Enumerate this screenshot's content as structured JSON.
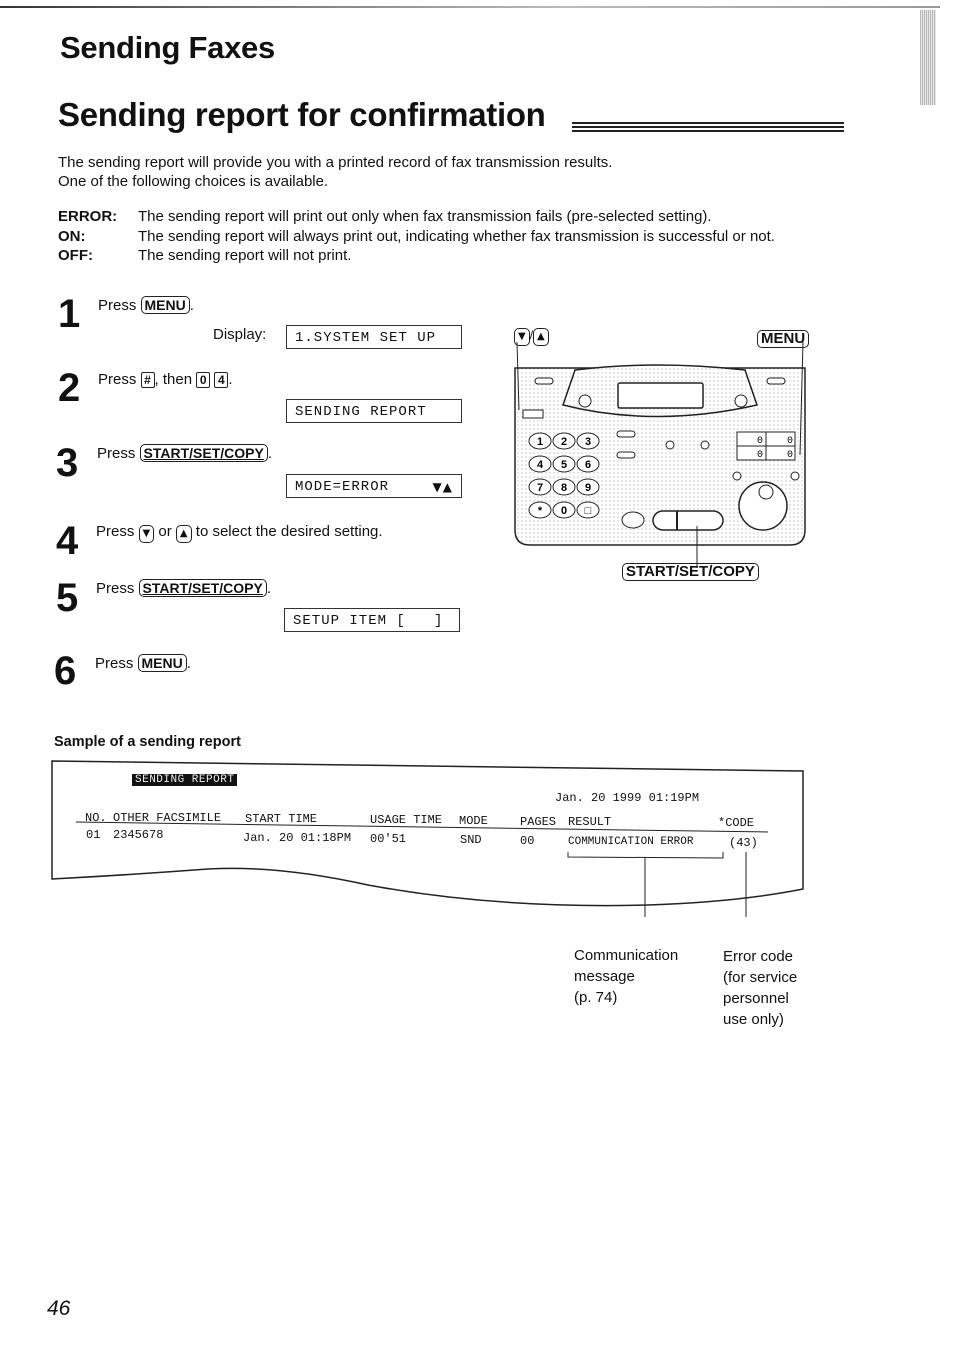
{
  "header": {
    "section_title": "Sending Faxes",
    "page_title": "Sending report for confirmation"
  },
  "intro": {
    "line1": "The sending report will provide you with a printed record of fax transmission results.",
    "line2": "One of the following choices is available."
  },
  "options": [
    {
      "key": "ERROR:",
      "desc": "The sending report will print out only when fax transmission fails (pre-selected setting)."
    },
    {
      "key": "ON:",
      "desc": "The sending report will always print out, indicating whether fax transmission is successful or not."
    },
    {
      "key": "OFF:",
      "desc": "The sending report will not print."
    }
  ],
  "steps": [
    {
      "num": "1",
      "pre": "Press",
      "keys": [
        "MENU"
      ],
      "post": ".",
      "display_label": "Display:",
      "display": "1.SYSTEM SET UP"
    },
    {
      "num": "2",
      "pre": "Press",
      "key_hash": "#",
      "mid": ", then",
      "digit_keys": [
        "0",
        "4"
      ],
      "post": ".",
      "display": "SENDING REPORT"
    },
    {
      "num": "3",
      "pre": "Press",
      "keys": [
        "START/SET/COPY"
      ],
      "post": ".",
      "display": "MODE=ERROR",
      "display_arrows": "▼▲"
    },
    {
      "num": "4",
      "pre": "Press",
      "key_down": "▼",
      "mid": "or",
      "key_up": "▲",
      "post": "to select the desired setting."
    },
    {
      "num": "5",
      "pre": "Press",
      "keys": [
        "START/SET/COPY"
      ],
      "post": ".",
      "display": "SETUP ITEM [   ]"
    },
    {
      "num": "6",
      "pre": "Press",
      "keys": [
        "MENU"
      ],
      "post": "."
    }
  ],
  "diagram": {
    "label_down": "▼",
    "label_sep": "/",
    "label_up": "▲",
    "label_menu": "MENU",
    "label_start": "START/SET/COPY",
    "keypad": [
      "1",
      "2",
      "3",
      "4",
      "5",
      "6",
      "7",
      "8",
      "9",
      "*",
      "0",
      "□"
    ],
    "counter_digits": [
      "0",
      "0",
      "0",
      "0"
    ]
  },
  "sample": {
    "heading": "Sample of a sending report",
    "report_title": "SENDING REPORT",
    "timestamp": "Jan. 20 1999 01:19PM",
    "columns": [
      "NO.",
      "OTHER FACSIMILE",
      "START TIME",
      "USAGE TIME",
      "MODE",
      "PAGES",
      "RESULT",
      "*CODE"
    ],
    "row": [
      "01",
      "2345678",
      "Jan. 20 01:18PM",
      "00'51",
      "SND",
      "00",
      "COMMUNICATION ERROR",
      "(43)"
    ],
    "callout_message": [
      "Communication",
      "message",
      "(p. 74)"
    ],
    "callout_code": [
      "Error code",
      "(for service",
      "personnel",
      "use only)"
    ]
  },
  "footer": {
    "page_number": "46"
  }
}
